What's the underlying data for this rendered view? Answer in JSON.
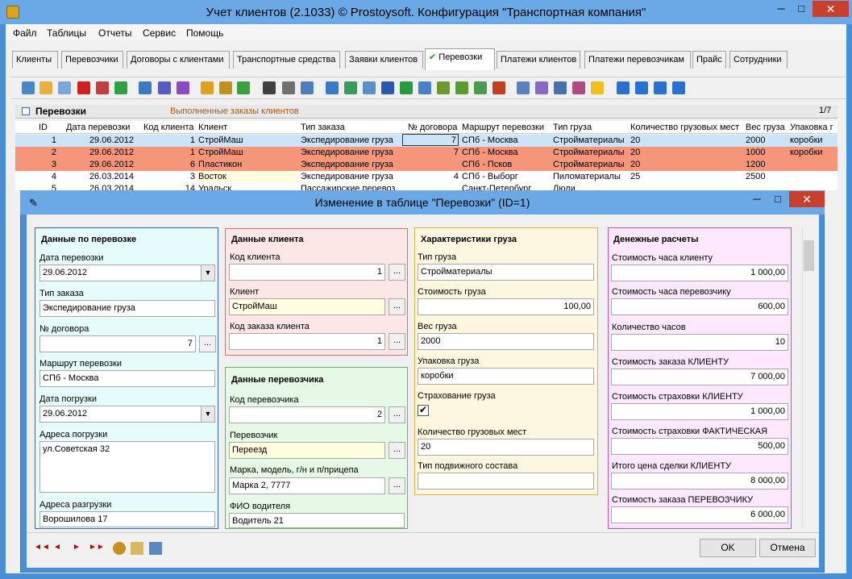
{
  "window": {
    "title": "Учет клиентов (2.1033) © Prostoysoft. Конфигурация \"Транспортная компания\"",
    "minimize": "─",
    "maximize": "□",
    "close": "✕"
  },
  "menu": [
    "Файл",
    "Таблицы",
    "Отчеты",
    "Сервис",
    "Помощь"
  ],
  "tabs": [
    "Клиенты",
    "Перевозчики",
    "Договоры с клиентами",
    "Транспортные средства",
    "Заявки клиентов",
    "Перевозки",
    "Платежи клиентов",
    "Платежи перевозчикам",
    "Прайс",
    "Сотрудники"
  ],
  "active_tab_check": "✔",
  "grid": {
    "title": "Перевозки",
    "subtitle": "Выполненные заказы клиентов",
    "page": "1/7",
    "columns": [
      "ID",
      "Дата перевозки",
      "Код клиента",
      "Клиент",
      "Тип заказа",
      "№ договора",
      "Маршрут перевозки",
      "Тип груза",
      "Количество грузовых мест",
      "Вес груза",
      "Упаковка г"
    ],
    "rows": [
      {
        "id": "1",
        "date": "29.06.2012",
        "client_code": "1",
        "client": "СтройМаш",
        "order_type": "Экспедирование груза",
        "contract": "7",
        "route": "СПб - Москва",
        "cargo": "Стройматериалы",
        "places": "20",
        "weight": "2000",
        "pack": "коробки"
      },
      {
        "id": "2",
        "date": "29.06.2012",
        "client_code": "1",
        "client": "СтройМаш",
        "order_type": "Экспедирование груза",
        "contract": "7",
        "route": "СПб - Москва",
        "cargo": "Стройматериалы",
        "places": "20",
        "weight": "1000",
        "pack": "коробки"
      },
      {
        "id": "3",
        "date": "29.06.2012",
        "client_code": "6",
        "client": "Пластикон",
        "order_type": "Экспедирование груза",
        "contract": "",
        "route": "СПб - Псков",
        "cargo": "Стройматериалы",
        "places": "20",
        "weight": "1200",
        "pack": ""
      },
      {
        "id": "4",
        "date": "26.03.2014",
        "client_code": "3",
        "client": "Восток",
        "order_type": "Экспедирование груза",
        "contract": "4",
        "route": "СПб - Выборг",
        "cargo": "Пиломатериалы",
        "places": "25",
        "weight": "2500",
        "pack": ""
      },
      {
        "id": "5",
        "date": "26.03.2014",
        "client_code": "14",
        "client": "Уральск",
        "order_type": "Пассажирские перевоз",
        "contract": "",
        "route": "Санкт-Петербург",
        "cargo": "Люди",
        "places": "",
        "weight": "",
        "pack": ""
      }
    ]
  },
  "dialog": {
    "title": "Изменение в таблице \"Перевозки\" (ID=1)",
    "minimize": "─",
    "maximize": "□",
    "close": "✕",
    "ok": "OK",
    "cancel": "Отмена",
    "panel1": {
      "title": "Данные по перевозке",
      "date_label": "Дата перевозки",
      "date_value": "29.06.2012",
      "order_type_label": "Тип заказа",
      "order_type_value": "Экспедирование груза",
      "contract_label": "№ договора",
      "contract_value": "7",
      "route_label": "Маршрут перевозки",
      "route_value": "СПб - Москва",
      "load_date_label": "Дата погрузки",
      "load_date_value": "29.06.2012",
      "load_addr_label": "Адреса погрузки",
      "load_addr_value": "ул.Советская 32",
      "unload_addr_label": "Адреса разгрузки",
      "unload_addr_value": "Ворошилова 17"
    },
    "panel2": {
      "title": "Данные клиента",
      "code_label": "Код клиента",
      "code_value": "1",
      "client_label": "Клиент",
      "client_value": "СтройМаш",
      "order_code_label": "Код заказа клиента",
      "order_code_value": "1"
    },
    "panel3": {
      "title": "Данные перевозчика",
      "code_label": "Код перевозчика",
      "code_value": "2",
      "carrier_label": "Перевозчик",
      "carrier_value": "Переезд",
      "car_label": "Марка, модель, г/н и п/прицепа",
      "car_value": "Марка 2, 7777",
      "driver_label": "ФИО водителя",
      "driver_value": "Водитель 21"
    },
    "panel4": {
      "title": "Характеристики груза",
      "type_label": "Тип груза",
      "type_value": "Стройматериалы",
      "cost_label": "Стоимость груза",
      "cost_value": "100,00",
      "weight_label": "Вес груза",
      "weight_value": "2000",
      "pack_label": "Упаковка груза",
      "pack_value": "коробки",
      "insurance_label": "Страхование груза",
      "insurance_check": "✔",
      "places_label": "Количество грузовых мест",
      "places_value": "20",
      "rolling_label": "Тип подвижного состава",
      "rolling_value": ""
    },
    "panel5": {
      "title": "Денежные расчеты",
      "f1_label": "Стоимость часа клиенту",
      "f1_value": "1 000,00",
      "f2_label": "Стоимость часа перевозчику",
      "f2_value": "600,00",
      "f3_label": "Количество часов",
      "f3_value": "10",
      "f4_label": "Стоимость заказа КЛИЕНТУ",
      "f4_value": "7 000,00",
      "f5_label": "Стоимость страховки КЛИЕНТУ",
      "f5_value": "1 000,00",
      "f6_label": "Стоимость страховки ФАКТИЧЕСКАЯ",
      "f6_value": "500,00",
      "f7_label": "Итого цена сделки КЛИЕНТУ",
      "f7_value": "8 000,00",
      "f8_label": "Стоимость заказа ПЕРЕВОЗЧИКУ",
      "f8_value": "6 000,00"
    },
    "nav": {
      "first": "◄◄",
      "prev": "◄",
      "next": "►",
      "last": "►►"
    }
  },
  "colors": {
    "row_selected": "#cde3f7",
    "row_orange": "#f5967a",
    "panel1": "#e6fbfb",
    "panel2": "#fde6e6",
    "panel3": "#e6f9e6",
    "panel4": "#fdf7e0",
    "panel5": "#fde8fd"
  }
}
